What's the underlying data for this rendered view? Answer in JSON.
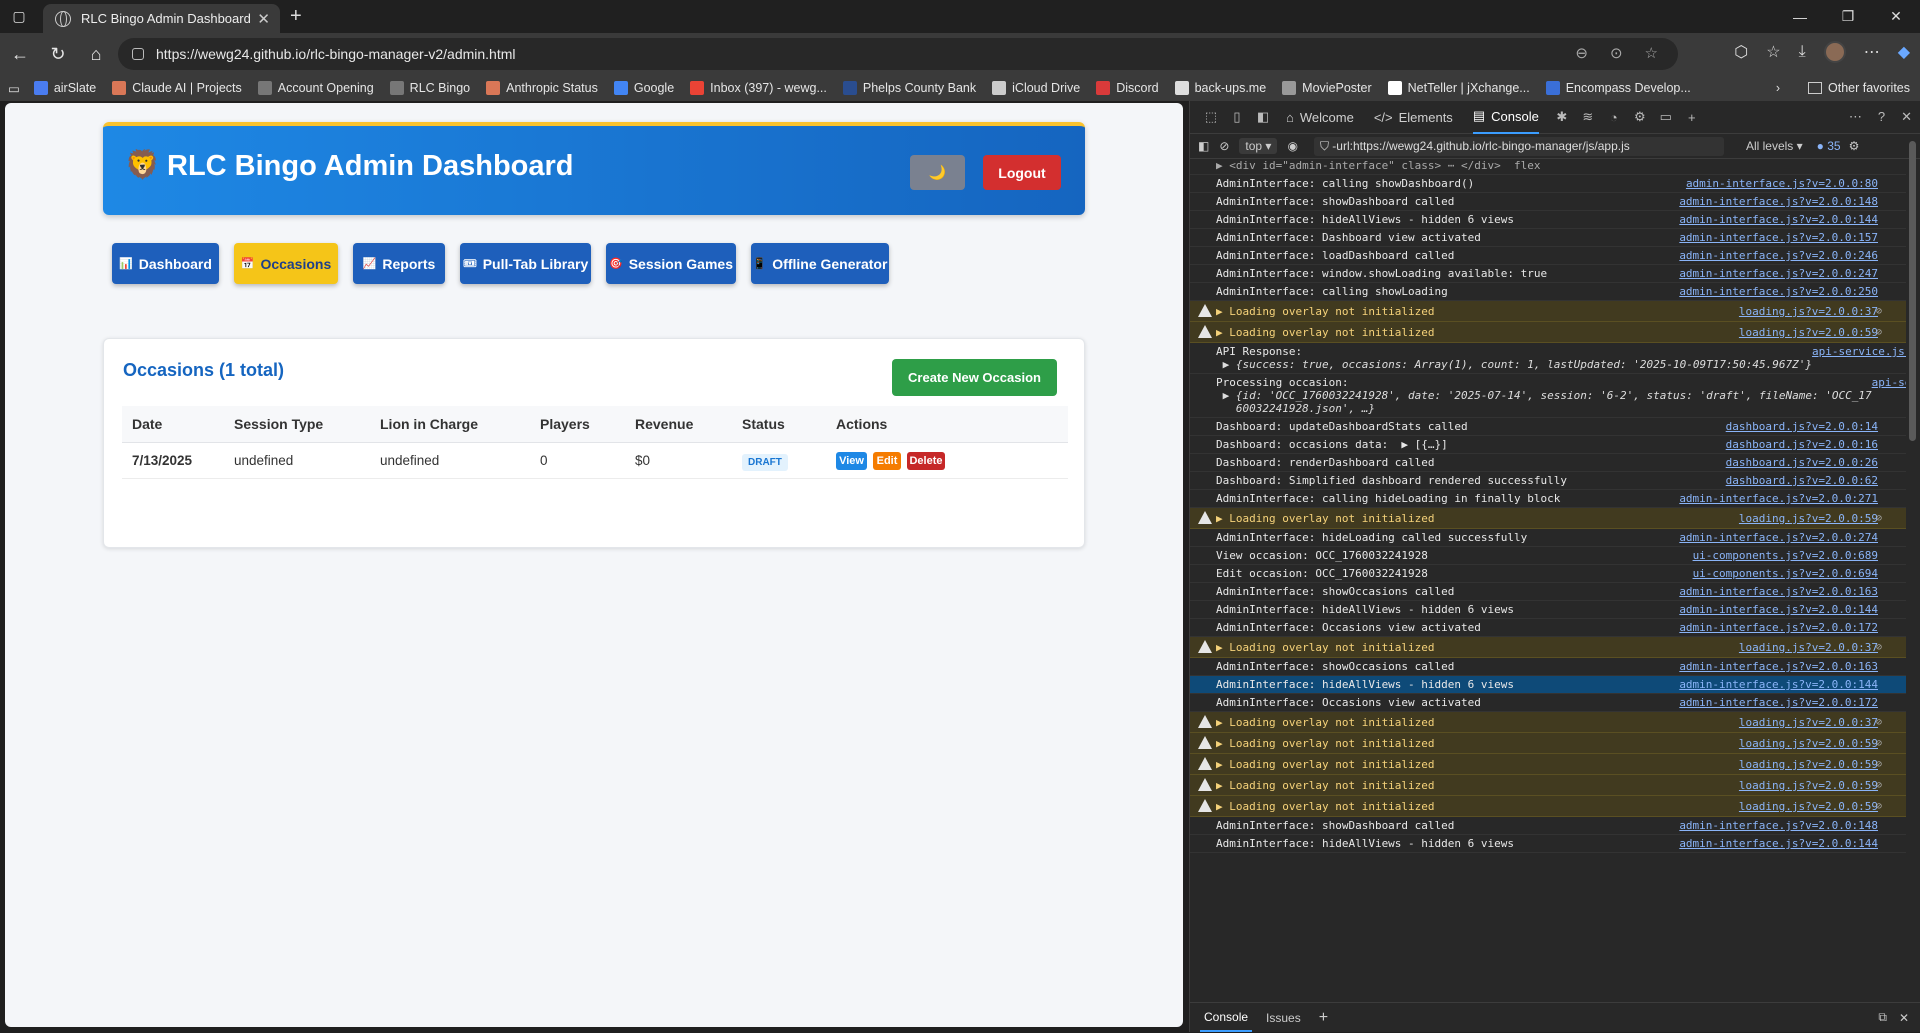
{
  "browser": {
    "tab_title": "RLC Bingo Admin Dashboard",
    "url": "https://wewg24.github.io/rlc-bingo-manager-v2/admin.html",
    "bookmarks": [
      {
        "label": "airSlate",
        "color": "#4a7cf0"
      },
      {
        "label": "Claude AI | Projects",
        "color": "#d97757"
      },
      {
        "label": "Account Opening",
        "color": "#777777"
      },
      {
        "label": "RLC Bingo",
        "color": "#777777"
      },
      {
        "label": "Anthropic Status",
        "color": "#d97757"
      },
      {
        "label": "Google",
        "color": "#4285f4"
      },
      {
        "label": "Inbox (397) - wewg...",
        "color": "#ea4335"
      },
      {
        "label": "Phelps County Bank",
        "color": "#2a4d8f"
      },
      {
        "label": "iCloud Drive",
        "color": "#cccccc"
      },
      {
        "label": "Discord",
        "color": "#d93a3a"
      },
      {
        "label": "back-ups.me",
        "color": "#dddddd"
      },
      {
        "label": "MoviePoster",
        "color": "#999999"
      },
      {
        "label": "NetTeller | jXchange...",
        "color": "#ffffff"
      },
      {
        "label": "Encompass Develop...",
        "color": "#3a6fd8"
      }
    ],
    "other_favorites": "Other favorites"
  },
  "app": {
    "title": "RLC Bingo Admin Dashboard",
    "logo": "🦁",
    "theme_toggle": "🌙",
    "logout": "Logout",
    "nav": [
      {
        "icon": "📊",
        "label": "Dashboard",
        "active": false
      },
      {
        "icon": "📅",
        "label": "Occasions",
        "active": true
      },
      {
        "icon": "📈",
        "label": "Reports",
        "active": false
      },
      {
        "icon": "🎟",
        "label": "Pull-Tab Library",
        "active": false
      },
      {
        "icon": "🎯",
        "label": "Session Games",
        "active": false
      },
      {
        "icon": "📱",
        "label": "Offline Generator",
        "active": false
      }
    ],
    "occasions": {
      "heading": "Occasions (1 total)",
      "create_label": "Create New Occasion",
      "columns": [
        "Date",
        "Session Type",
        "Lion in Charge",
        "Players",
        "Revenue",
        "Status",
        "Actions"
      ],
      "rows": [
        {
          "date": "7/13/2025",
          "session_type": "undefined",
          "lion": "undefined",
          "players": "0",
          "revenue": "$0",
          "status": "DRAFT"
        }
      ],
      "actions": {
        "view": "View",
        "edit": "Edit",
        "delete": "Delete"
      }
    }
  },
  "devtools": {
    "tabs": [
      "Welcome",
      "Elements",
      "Console"
    ],
    "active_tab": "Console",
    "context": "top",
    "filter": "-url:https://wewg24.github.io/rlc-bingo-manager/js/app.js",
    "levels": "All levels",
    "issue_count": "35",
    "top_snippet": "▶ <div id=\"admin-interface\" class> ⋯ </div>  flex",
    "bottom_tabs": [
      "Console",
      "Issues"
    ],
    "lines": [
      {
        "type": "log",
        "msg": "AdminInterface: calling showDashboard()",
        "src": "admin-interface.js?v=2.0.0:80"
      },
      {
        "type": "log",
        "msg": "AdminInterface: showDashboard called",
        "src": "admin-interface.js?v=2.0.0:148"
      },
      {
        "type": "log",
        "msg": "AdminInterface: hideAllViews - hidden 6 views",
        "src": "admin-interface.js?v=2.0.0:144"
      },
      {
        "type": "log",
        "msg": "AdminInterface: Dashboard view activated",
        "src": "admin-interface.js?v=2.0.0:157"
      },
      {
        "type": "log",
        "msg": "AdminInterface: loadDashboard called",
        "src": "admin-interface.js?v=2.0.0:246"
      },
      {
        "type": "log",
        "msg": "AdminInterface: window.showLoading available: true",
        "src": "admin-interface.js?v=2.0.0:247"
      },
      {
        "type": "log",
        "msg": "AdminInterface: calling showLoading",
        "src": "admin-interface.js?v=2.0.0:250"
      },
      {
        "type": "warn",
        "msg": "▶ Loading overlay not initialized",
        "src": "loading.js?v=2.0.0:37"
      },
      {
        "type": "warn",
        "msg": "▶ Loading overlay not initialized",
        "src": "loading.js?v=2.0.0:59"
      },
      {
        "type": "multi",
        "msg": "API Response:",
        "sub": " ▶ {success: true, occasions: Array(1), count: 1, lastUpdated: '2025-10-09T17:50:45.967Z'}",
        "src": "api-service.js?v=2.0.0:71"
      },
      {
        "type": "multi",
        "msg": "Processing occasion:",
        "sub": " ▶ {id: 'OCC_1760032241928', date: '2025-07-14', session: '6-2', status: 'draft', fileName: 'OCC_17\n   60032241928.json', …}",
        "src": "api-service.js?v=2.0.0:76"
      },
      {
        "type": "log",
        "msg": "Dashboard: updateDashboardStats called",
        "src": "dashboard.js?v=2.0.0:14"
      },
      {
        "type": "log",
        "msg": "Dashboard: occasions data:  ▶ [{…}]",
        "src": "dashboard.js?v=2.0.0:16"
      },
      {
        "type": "log",
        "msg": "Dashboard: renderDashboard called",
        "src": "dashboard.js?v=2.0.0:26"
      },
      {
        "type": "log",
        "msg": "Dashboard: Simplified dashboard rendered successfully",
        "src": "dashboard.js?v=2.0.0:62"
      },
      {
        "type": "log",
        "msg": "AdminInterface: calling hideLoading in finally block",
        "src": "admin-interface.js?v=2.0.0:271"
      },
      {
        "type": "warn",
        "msg": "▶ Loading overlay not initialized",
        "src": "loading.js?v=2.0.0:59"
      },
      {
        "type": "log",
        "msg": "AdminInterface: hideLoading called successfully",
        "src": "admin-interface.js?v=2.0.0:274"
      },
      {
        "type": "log",
        "msg": "View occasion: OCC_1760032241928",
        "src": "ui-components.js?v=2.0.0:689"
      },
      {
        "type": "log",
        "msg": "Edit occasion: OCC_1760032241928",
        "src": "ui-components.js?v=2.0.0:694"
      },
      {
        "type": "log",
        "msg": "AdminInterface: showOccasions called",
        "src": "admin-interface.js?v=2.0.0:163"
      },
      {
        "type": "log",
        "msg": "AdminInterface: hideAllViews - hidden 6 views",
        "src": "admin-interface.js?v=2.0.0:144"
      },
      {
        "type": "log",
        "msg": "AdminInterface: Occasions view activated",
        "src": "admin-interface.js?v=2.0.0:172"
      },
      {
        "type": "warn",
        "msg": "▶ Loading overlay not initialized",
        "src": "loading.js?v=2.0.0:37"
      },
      {
        "type": "log",
        "msg": "AdminInterface: showOccasions called",
        "src": "admin-interface.js?v=2.0.0:163"
      },
      {
        "type": "selected",
        "msg": "AdminInterface: hideAllViews - hidden 6 views",
        "src": "admin-interface.js?v=2.0.0:144"
      },
      {
        "type": "log",
        "msg": "AdminInterface: Occasions view activated",
        "src": "admin-interface.js?v=2.0.0:172"
      },
      {
        "type": "warn",
        "msg": "▶ Loading overlay not initialized",
        "src": "loading.js?v=2.0.0:37"
      },
      {
        "type": "warn",
        "msg": "▶ Loading overlay not initialized",
        "src": "loading.js?v=2.0.0:59"
      },
      {
        "type": "warn",
        "msg": "▶ Loading overlay not initialized",
        "src": "loading.js?v=2.0.0:59"
      },
      {
        "type": "warn",
        "msg": "▶ Loading overlay not initialized",
        "src": "loading.js?v=2.0.0:59"
      },
      {
        "type": "warn",
        "msg": "▶ Loading overlay not initialized",
        "src": "loading.js?v=2.0.0:59"
      },
      {
        "type": "log",
        "msg": "AdminInterface: showDashboard called",
        "src": "admin-interface.js?v=2.0.0:148"
      },
      {
        "type": "log",
        "msg": "AdminInterface: hideAllViews - hidden 6 views",
        "src": "admin-interface.js?v=2.0.0:144"
      }
    ]
  }
}
